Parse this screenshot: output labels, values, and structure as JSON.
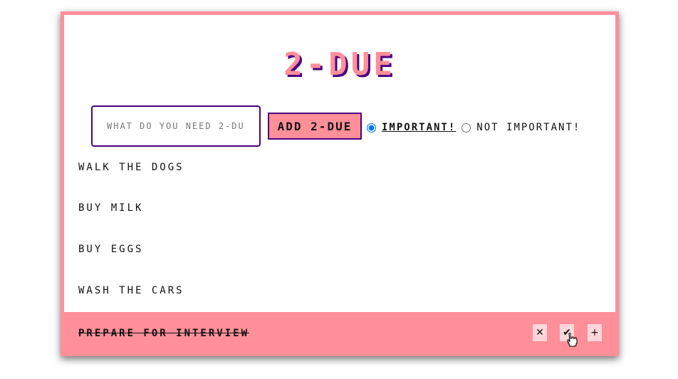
{
  "app": {
    "title": "2-DUE",
    "input_placeholder": "WHAT DO YOU NEED 2-DU",
    "add_button_label": "ADD 2-DUE",
    "radio_options": [
      {
        "label": "IMPORTANT!",
        "checked": true
      },
      {
        "label": "NOT IMPORTANT!",
        "checked": false
      }
    ]
  },
  "tasks": [
    "WALK THE DOGS",
    "BUY MILK",
    "BUY EGGS",
    "WASH THE CARS"
  ],
  "hovered_task": {
    "label": "PREPARE FOR INTERVIEW",
    "actions": {
      "delete_icon": "✕",
      "complete_icon": "✔",
      "important_icon": "+"
    }
  },
  "colors": {
    "accent_pink": "#ff8f99",
    "accent_purple": "#4b0082",
    "action_button_bg": "#ffd6d9"
  }
}
